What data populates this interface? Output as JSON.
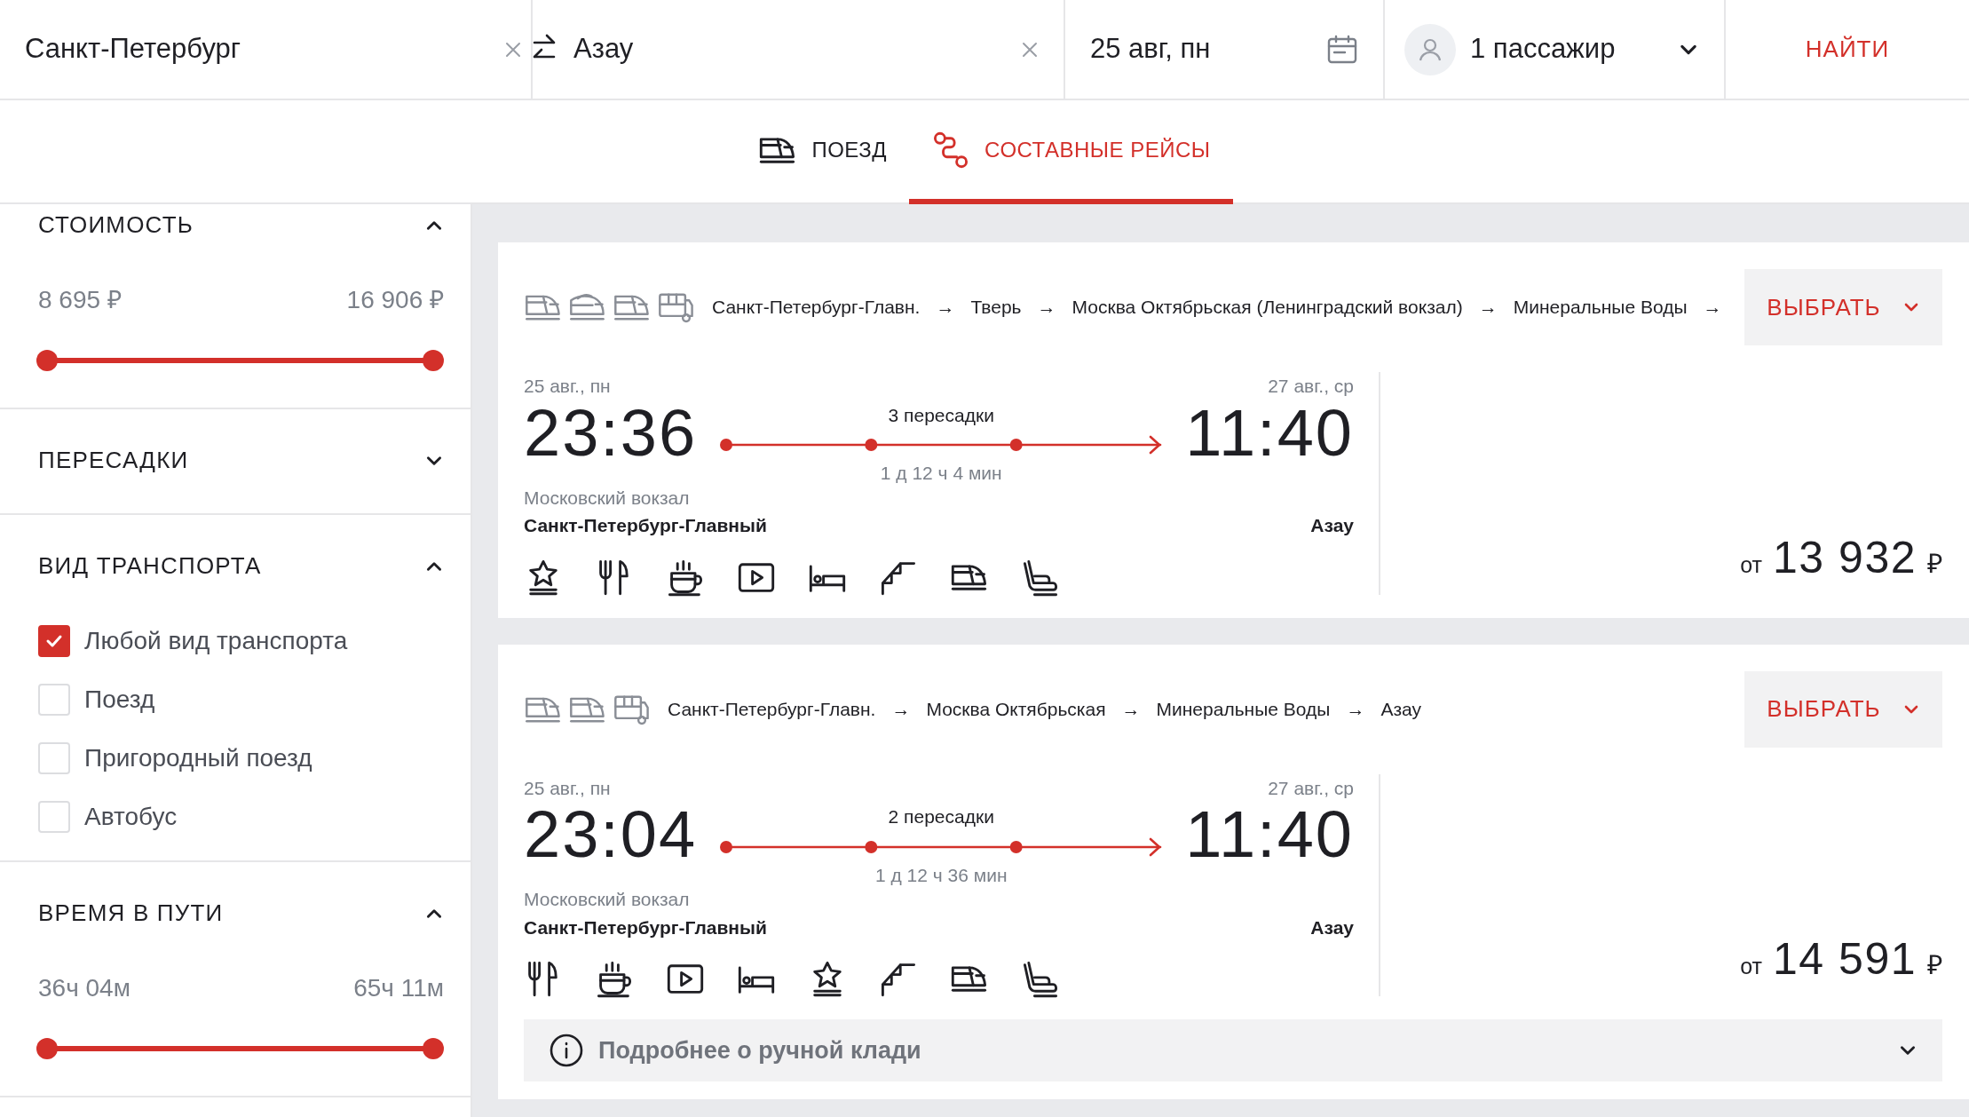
{
  "search": {
    "from": "Санкт-Петербург",
    "to": "Азау",
    "date": "25 авг, пн",
    "passengers": "1 пассажир",
    "button": "НАЙТИ"
  },
  "tabs": [
    {
      "label": "ПОЕЗД",
      "kind": "train",
      "selected": false
    },
    {
      "label": "СОСТАВНЫЕ РЕЙСЫ",
      "kind": "route",
      "selected": true
    }
  ],
  "filters": [
    {
      "kind": "range",
      "title": "СТОИМОСТЬ",
      "expanded": true,
      "min": "8 695 ₽",
      "max": "16 906 ₽",
      "level": 1
    },
    {
      "title": "ПЕРЕСАДКИ",
      "expanded": false
    },
    {
      "kind": "checklist",
      "title": "ВИД ТРАНСПОРТА",
      "expanded": true,
      "options": [
        {
          "label": "Любой вид транспорта",
          "checked": true
        },
        {
          "label": "Поезд",
          "checked": false
        },
        {
          "label": "Пригородный поезд",
          "checked": false
        },
        {
          "label": "Автобус",
          "checked": false
        }
      ]
    },
    {
      "kind": "range",
      "title": "ВРЕМЯ В ПУТИ",
      "expanded": true,
      "min": "36ч 04м",
      "max": "65ч 11м",
      "level": 1
    }
  ],
  "results": [
    {
      "transports": [
        {
          "kind": "train"
        },
        {
          "kind": "express"
        },
        {
          "kind": "train"
        },
        {
          "kind": "bus"
        }
      ],
      "route": [
        "Санкт-Петербург-Главн.",
        "Тверь",
        "Москва Октябрьская (Ленинградский вокзал)",
        "Минеральные Воды"
      ],
      "route_arrows": [
        "→",
        "→",
        "→",
        "→"
      ],
      "button": "ВЫБРАТЬ",
      "depart_date": "25 авг., пн",
      "depart_time": "23:36",
      "transfers": "3 пересадки",
      "duration": "1 д 12 ч 4 мин",
      "arrive_date": "27 авг., ср",
      "arrive_time": "11:40",
      "depart_note": "Московский вокзал",
      "depart_station": "Санкт-Петербург-Главный",
      "arrive_station": "Азау",
      "amenities": [
        {
          "kind": "star"
        },
        {
          "kind": "cutlery"
        },
        {
          "kind": "coffee"
        },
        {
          "kind": "video"
        },
        {
          "kind": "bed"
        },
        {
          "kind": "stairs"
        },
        {
          "kind": "train"
        },
        {
          "kind": "seat"
        }
      ],
      "price_prefix": "от",
      "price": "13 932",
      "currency": "₽"
    },
    {
      "transports": [
        {
          "kind": "train"
        },
        {
          "kind": "train"
        },
        {
          "kind": "bus"
        }
      ],
      "route": [
        "Санкт-Петербург-Главн.",
        "Москва Октябрьская",
        "Минеральные Воды",
        "Азау"
      ],
      "route_arrows": [
        "→",
        "→",
        "→"
      ],
      "button": "ВЫБРАТЬ",
      "depart_date": "25 авг., пн",
      "depart_time": "23:04",
      "transfers": "2 пересадки",
      "duration": "1 д 12 ч 36 мин",
      "arrive_date": "27 авг., ср",
      "arrive_time": "11:40",
      "depart_note": "Московский вокзал",
      "depart_station": "Санкт-Петербург-Главный",
      "arrive_station": "Азау",
      "amenities": [
        {
          "kind": "cutlery"
        },
        {
          "kind": "coffee"
        },
        {
          "kind": "video"
        },
        {
          "kind": "bed"
        },
        {
          "kind": "star"
        },
        {
          "kind": "stairs"
        },
        {
          "kind": "train"
        },
        {
          "kind": "seat"
        }
      ],
      "price_prefix": "от",
      "price": "14 591",
      "currency": "₽",
      "info": "Подробнее о ручной клади"
    }
  ]
}
